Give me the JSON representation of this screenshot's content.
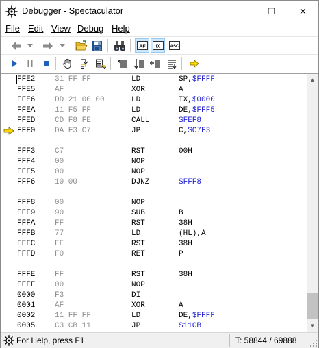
{
  "window": {
    "title": "Debugger - Spectaculator",
    "minimize": "—",
    "maximize": "☐",
    "close": "✕"
  },
  "menu": [
    "File",
    "Edit",
    "View",
    "Debug",
    "Help"
  ],
  "toolbar_main": {
    "af_label": "AF",
    "ix_label": "IX",
    "asc_label": "ASC"
  },
  "listing": [
    {
      "addr": "FFE2",
      "bytes": "31 FF FF",
      "mnem": "LD",
      "ops": "SP,",
      "hex": "$FFFF"
    },
    {
      "addr": "FFE5",
      "bytes": "AF",
      "mnem": "XOR",
      "ops": "A",
      "hex": ""
    },
    {
      "addr": "FFE6",
      "bytes": "DD 21 00 00",
      "mnem": "LD",
      "ops": "IX,",
      "hex": "$0000"
    },
    {
      "addr": "FFEA",
      "bytes": "11 F5 FF",
      "mnem": "LD",
      "ops": "DE,",
      "hex": "$FFF5"
    },
    {
      "addr": "FFED",
      "bytes": "CD F8 FE",
      "mnem": "CALL",
      "ops": "",
      "hex": "$FEF8"
    },
    {
      "addr": "FFF0",
      "bytes": "DA F3 C7",
      "mnem": "JP",
      "ops": "C,",
      "hex": "$C7F3",
      "current": true
    },
    {
      "addr": "",
      "bytes": "",
      "mnem": "",
      "ops": "",
      "hex": ""
    },
    {
      "addr": "FFF3",
      "bytes": "C7",
      "mnem": "RST",
      "ops": "00H",
      "hex": ""
    },
    {
      "addr": "FFF4",
      "bytes": "00",
      "mnem": "NOP",
      "ops": "",
      "hex": ""
    },
    {
      "addr": "FFF5",
      "bytes": "00",
      "mnem": "NOP",
      "ops": "",
      "hex": ""
    },
    {
      "addr": "FFF6",
      "bytes": "10 00",
      "mnem": "DJNZ",
      "ops": "",
      "hex": "$FFF8"
    },
    {
      "addr": "",
      "bytes": "",
      "mnem": "",
      "ops": "",
      "hex": ""
    },
    {
      "addr": "FFF8",
      "bytes": "00",
      "mnem": "NOP",
      "ops": "",
      "hex": ""
    },
    {
      "addr": "FFF9",
      "bytes": "90",
      "mnem": "SUB",
      "ops": "B",
      "hex": ""
    },
    {
      "addr": "FFFA",
      "bytes": "FF",
      "mnem": "RST",
      "ops": "38H",
      "hex": ""
    },
    {
      "addr": "FFFB",
      "bytes": "77",
      "mnem": "LD",
      "ops": "(HL),A",
      "hex": ""
    },
    {
      "addr": "FFFC",
      "bytes": "FF",
      "mnem": "RST",
      "ops": "38H",
      "hex": ""
    },
    {
      "addr": "FFFD",
      "bytes": "F0",
      "mnem": "RET",
      "ops": "P",
      "hex": ""
    },
    {
      "addr": "",
      "bytes": "",
      "mnem": "",
      "ops": "",
      "hex": ""
    },
    {
      "addr": "FFFE",
      "bytes": "FF",
      "mnem": "RST",
      "ops": "38H",
      "hex": ""
    },
    {
      "addr": "FFFF",
      "bytes": "00",
      "mnem": "NOP",
      "ops": "",
      "hex": ""
    },
    {
      "addr": "0000",
      "bytes": "F3",
      "mnem": "DI",
      "ops": "",
      "hex": ""
    },
    {
      "addr": "0001",
      "bytes": "AF",
      "mnem": "XOR",
      "ops": "A",
      "hex": ""
    },
    {
      "addr": "0002",
      "bytes": "11 FF FF",
      "mnem": "LD",
      "ops": "DE,",
      "hex": "$FFFF"
    },
    {
      "addr": "0005",
      "bytes": "C3 CB 11",
      "mnem": "JP",
      "ops": "",
      "hex": "$11CB"
    }
  ],
  "status": {
    "help": "For Help, press F1",
    "tstates": "T: 58844 / 69888"
  },
  "colors": {
    "hex_operand": "#2020d0",
    "bytes": "#8c8c8c",
    "current_marker": "#ffd700",
    "play_blue": "#1e5fbf"
  }
}
